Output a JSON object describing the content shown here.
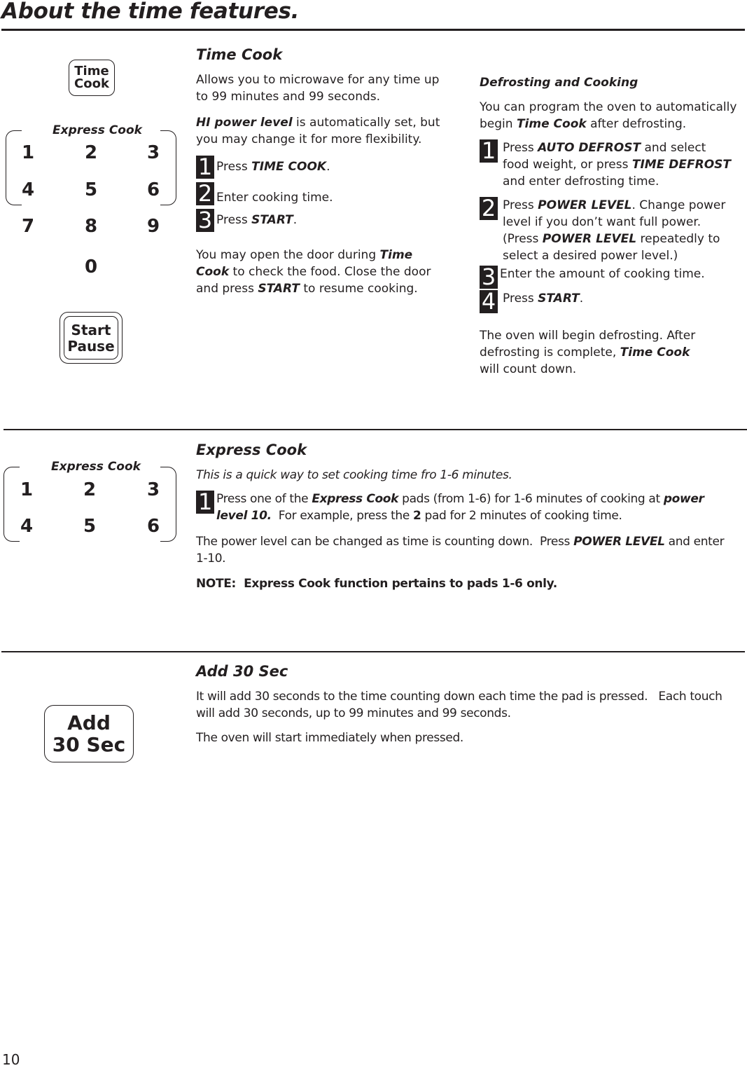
{
  "page": {
    "title": "About the time features.",
    "page_number": "10"
  },
  "keypad": {
    "time_cook_btn": [
      "Time",
      "Cook"
    ],
    "express_cook_label": "Express Cook",
    "keys": [
      "1",
      "2",
      "3",
      "4",
      "5",
      "6",
      "7",
      "8",
      "9",
      "0"
    ],
    "start_btn": [
      "Start",
      "Pause"
    ],
    "express_keys": [
      "1",
      "2",
      "3",
      "4",
      "5",
      "6"
    ],
    "add30_btn": [
      "Add",
      "30 Sec"
    ]
  },
  "time_cook": {
    "heading": "Time Cook",
    "intro": "Allows you to microwave for any time up to 99 minutes and 99 seconds.",
    "hi_power_bold": "HI power level",
    "hi_power_rest": " is automatically set, but you may change it for more flexibility.",
    "steps": [
      {
        "n": "1",
        "pre": "Press ",
        "bold": "TIME COOK",
        "post": "."
      },
      {
        "n": "2",
        "pre": "Enter cooking time.",
        "bold": "",
        "post": ""
      },
      {
        "n": "3",
        "pre": "Press ",
        "bold": "START",
        "post": "."
      }
    ],
    "door_pre": "You may open the door during ",
    "door_bold1": "Time Cook",
    "door_mid": " to check the food. Close the door and press ",
    "door_bold2": "START",
    "door_post": " to resume cooking."
  },
  "defrost": {
    "heading": "Defrosting and Cooking",
    "intro_pre": "You can program the oven to automatically begin ",
    "intro_bold": "Time Cook",
    "intro_post": " after defrosting.",
    "steps": [
      {
        "n": "1",
        "parts": [
          [
            "",
            "Press "
          ],
          [
            "bi",
            "AUTO DEFROST"
          ],
          [
            "",
            " and select food weight, or press "
          ],
          [
            "bi",
            "TIME DEFROST"
          ],
          [
            "",
            " and enter defrosting time."
          ]
        ]
      },
      {
        "n": "2",
        "parts": [
          [
            "",
            "Press "
          ],
          [
            "bi",
            "POWER LEVEL"
          ],
          [
            "",
            ". Change power level if you don’t want full power. (Press "
          ],
          [
            "bi",
            "POWER LEVEL"
          ],
          [
            "",
            " repeatedly to select a desired power level.)"
          ]
        ]
      },
      {
        "n": "3",
        "parts": [
          [
            "",
            "Enter the amount of cooking time."
          ]
        ]
      },
      {
        "n": "4",
        "parts": [
          [
            "",
            "Press "
          ],
          [
            "bi",
            "START"
          ],
          [
            "",
            "."
          ]
        ]
      }
    ],
    "outro_pre": "The oven will begin defrosting. After defrosting is complete, ",
    "outro_bold": "Time Cook",
    "outro_post": " will count down."
  },
  "express_cook": {
    "heading": "Express Cook",
    "intro": "This is a quick way to set cooking time fro 1-6 minutes.",
    "step_n": "1",
    "step_pre": "Press one of the ",
    "step_bold1": "Express Cook",
    "step_mid": " pads (from 1-6) for 1-6 minutes of cooking at ",
    "step_bold2": "power level 10.",
    "step_mid2": "  For example, press the ",
    "step_bold3": "2",
    "step_post": " pad for 2 minutes of cooking time.",
    "power_pre": "The power level can be changed as time is counting down.  Press ",
    "power_bold": "POWER LEVEL",
    "power_post": " and enter 1-10.",
    "note": "NOTE:  Express Cook function pertains to pads 1-6 only."
  },
  "add30": {
    "heading": "Add 30 Sec",
    "p1": "It will add 30 seconds to the time counting down each time the pad is pressed.   Each touch will add 30 seconds, up to 99 minutes and 99 seconds.",
    "p2": "The oven will start immediately when pressed."
  }
}
